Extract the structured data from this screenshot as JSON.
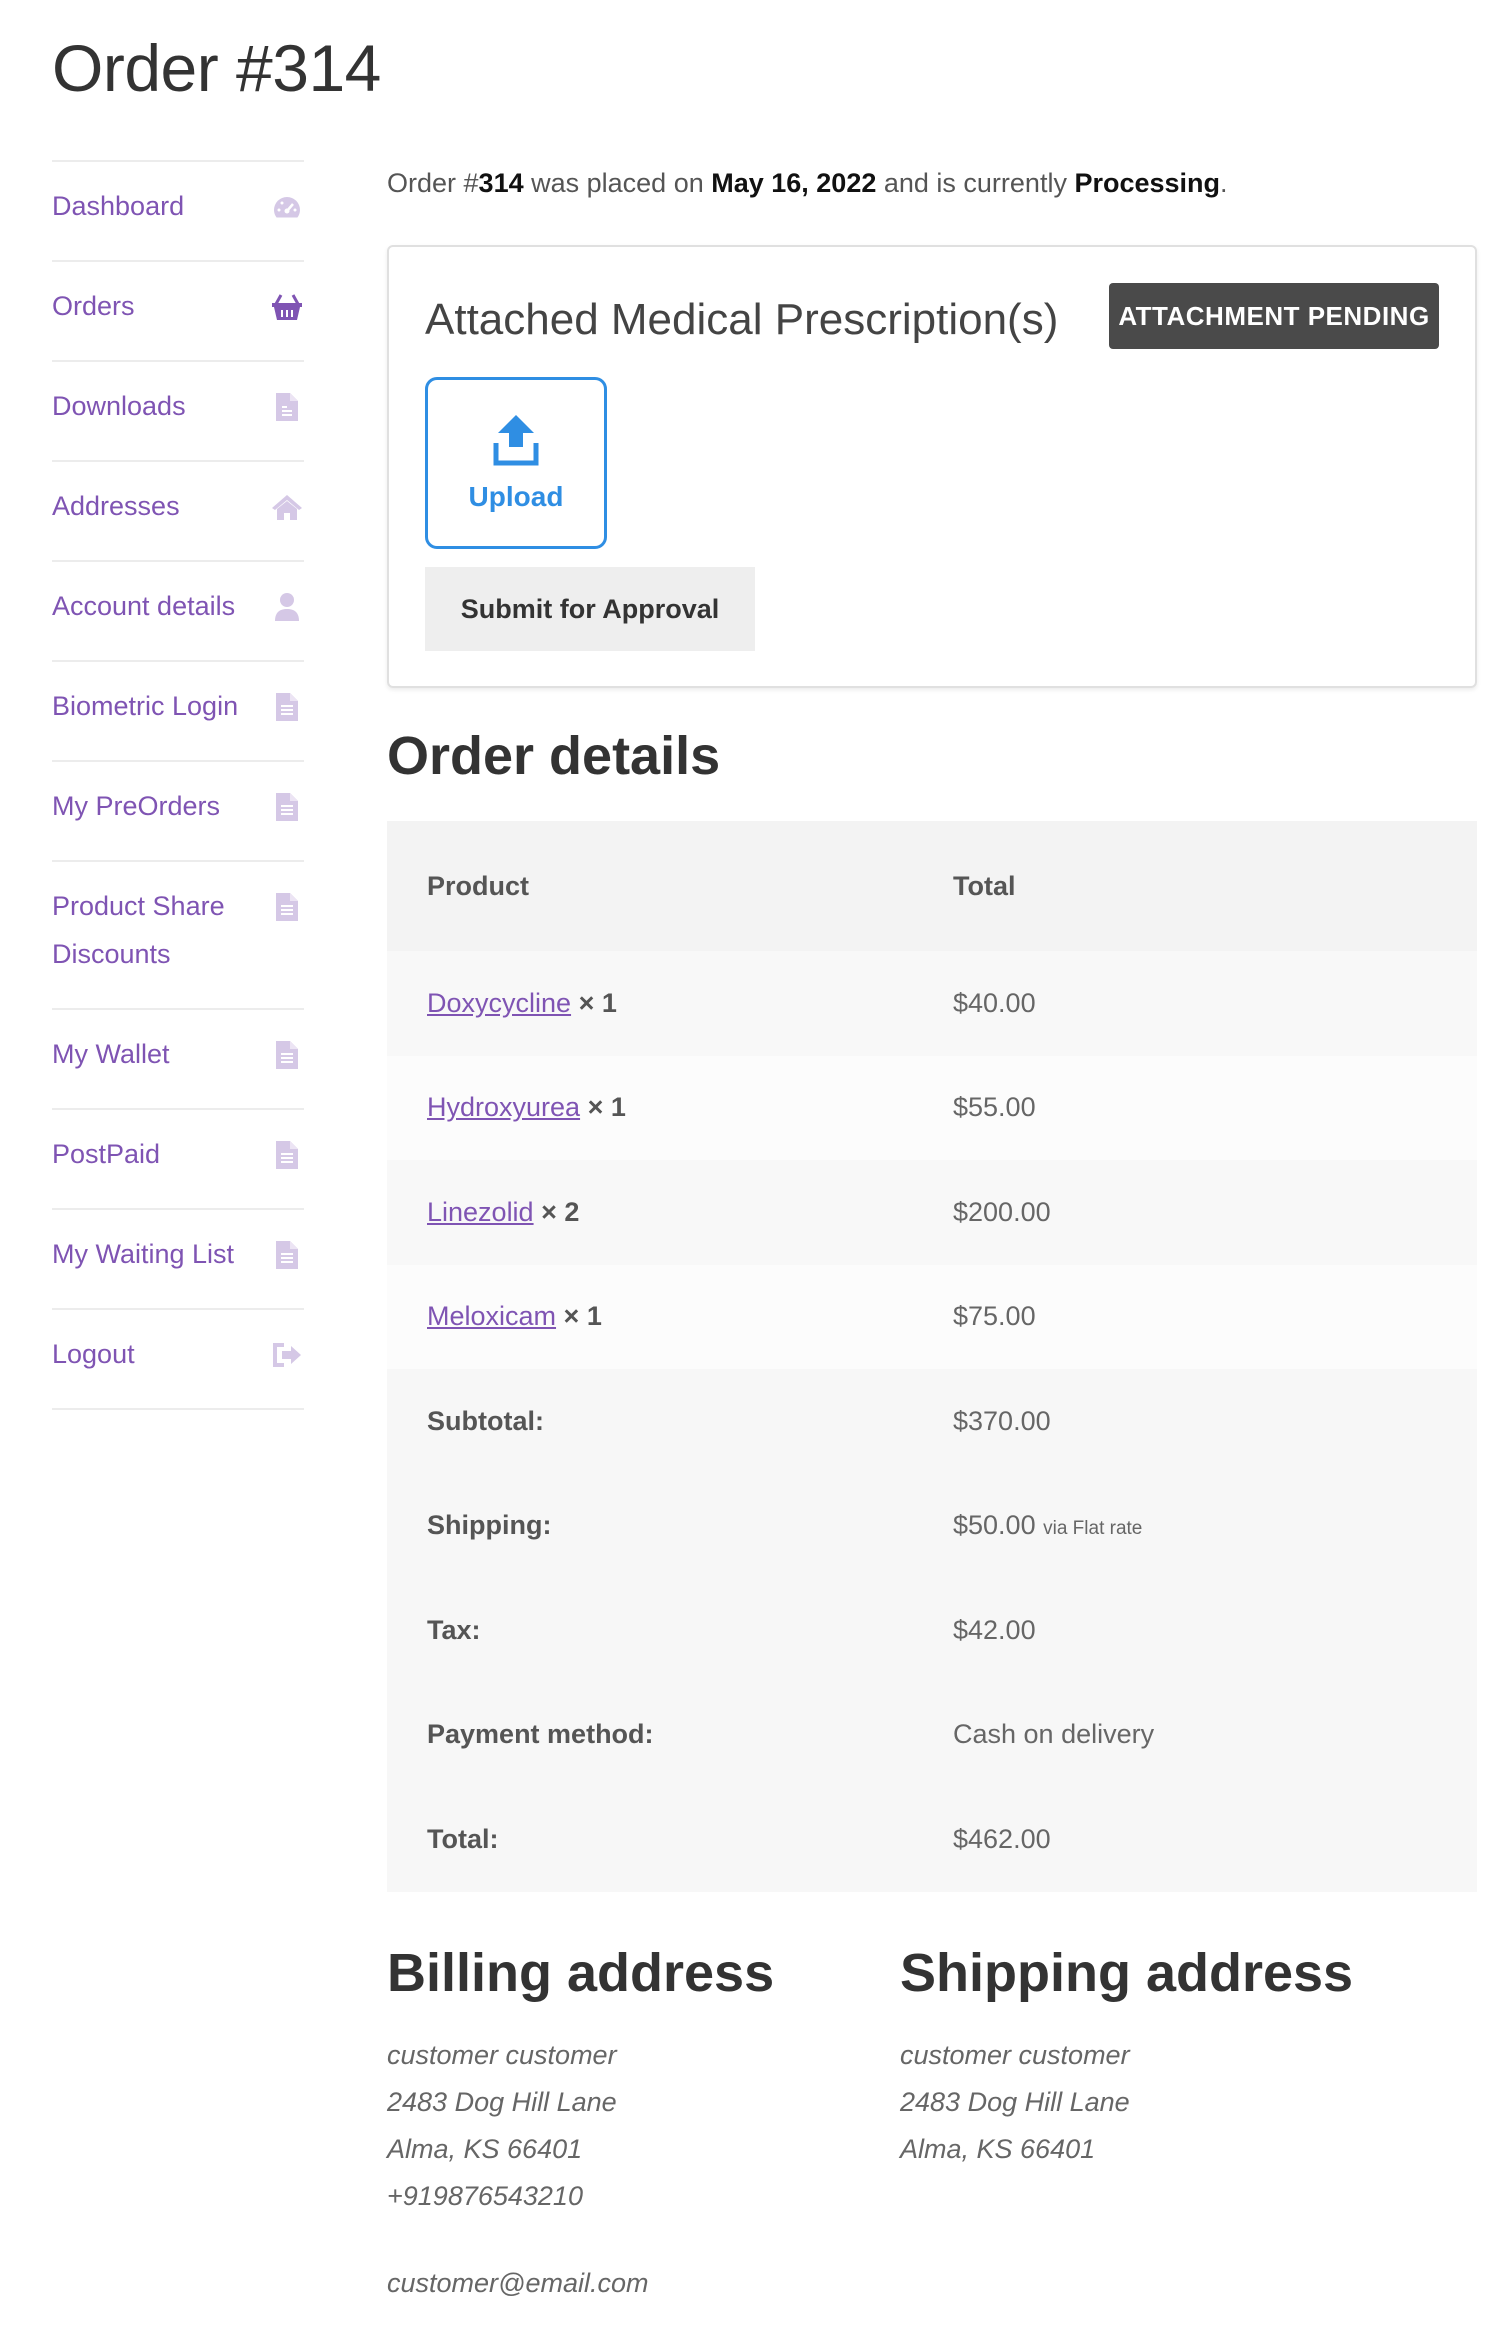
{
  "page": {
    "title": "Order #314"
  },
  "sidebar": {
    "items": [
      {
        "label": "Dashboard",
        "icon": "dashboard-icon",
        "active": false
      },
      {
        "label": "Orders",
        "icon": "basket-icon",
        "active": true
      },
      {
        "label": "Downloads",
        "icon": "file-icon",
        "active": false
      },
      {
        "label": "Addresses",
        "icon": "home-icon",
        "active": false
      },
      {
        "label": "Account details",
        "icon": "user-icon",
        "active": false
      },
      {
        "label": "Biometric Login",
        "icon": "document-icon",
        "active": false
      },
      {
        "label": "My PreOrders",
        "icon": "document-icon",
        "active": false
      },
      {
        "label": "Product Share Discounts",
        "icon": "document-icon",
        "active": false
      },
      {
        "label": "My Wallet",
        "icon": "document-icon",
        "active": false
      },
      {
        "label": "PostPaid",
        "icon": "document-icon",
        "active": false
      },
      {
        "label": "My Waiting List",
        "icon": "document-icon",
        "active": false
      },
      {
        "label": "Logout",
        "icon": "logout-icon",
        "active": false
      }
    ]
  },
  "intro": {
    "prefix": "Order #",
    "order_number": "314",
    "mid": " was placed on ",
    "date": "May 16, 2022",
    "mid2": " and is currently ",
    "status": "Processing",
    "suffix": "."
  },
  "prescription": {
    "title": "Attached Medical Prescription(s)",
    "badge": "ATTACHMENT PENDING",
    "upload_label": "Upload",
    "submit_label": "Submit for Approval"
  },
  "order_details": {
    "title": "Order details",
    "headers": {
      "product": "Product",
      "total": "Total"
    },
    "items": [
      {
        "name": "Doxycycline",
        "qty": "× 1",
        "total": "$40.00"
      },
      {
        "name": "Hydroxyurea",
        "qty": "× 1",
        "total": "$55.00"
      },
      {
        "name": "Linezolid",
        "qty": "× 2",
        "total": "$200.00"
      },
      {
        "name": "Meloxicam",
        "qty": "× 1",
        "total": "$75.00"
      }
    ],
    "totals": [
      {
        "label": "Subtotal:",
        "value": "$370.00",
        "note": ""
      },
      {
        "label": "Shipping:",
        "value": "$50.00",
        "note": "via Flat rate"
      },
      {
        "label": "Tax:",
        "value": "$42.00",
        "note": ""
      },
      {
        "label": "Payment method:",
        "value": "Cash on delivery",
        "note": ""
      },
      {
        "label": "Total:",
        "value": "$462.00",
        "note": ""
      }
    ]
  },
  "billing": {
    "title": "Billing address",
    "lines": [
      "customer customer",
      "2483 Dog Hill Lane",
      "Alma, KS 66401",
      "+919876543210"
    ],
    "email": "customer@email.com"
  },
  "shipping": {
    "title": "Shipping address",
    "lines": [
      "customer customer",
      "2483 Dog Hill Lane",
      "Alma, KS 66401"
    ]
  },
  "colors": {
    "link": "#7f54b3",
    "icon_muted": "#d5c8e6",
    "upload_blue": "#2f8ee3",
    "badge_bg": "#4a4a4a"
  }
}
